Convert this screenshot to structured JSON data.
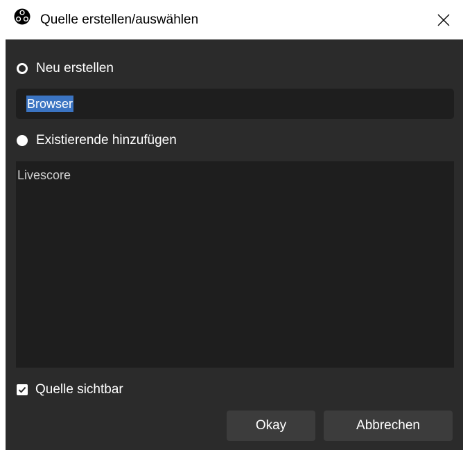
{
  "window": {
    "title": "Quelle erstellen/auswählen",
    "icon": "obs-logo-icon",
    "close_icon": "close-icon"
  },
  "options": {
    "create_new_label": "Neu erstellen",
    "create_new_selected": true,
    "existing_label": "Existierende hinzufügen",
    "existing_selected": false
  },
  "name_input": {
    "value": "Browser",
    "text_selected": true
  },
  "existing_sources": {
    "items": [
      "Livescore"
    ]
  },
  "visible_checkbox": {
    "label": "Quelle sichtbar",
    "checked": true
  },
  "buttons": {
    "ok_label": "Okay",
    "cancel_label": "Abbrechen"
  },
  "colors": {
    "background": "#2b2b2b",
    "field": "#1e1e1e",
    "button": "#3c3c3c",
    "selection": "#3b74c2"
  }
}
